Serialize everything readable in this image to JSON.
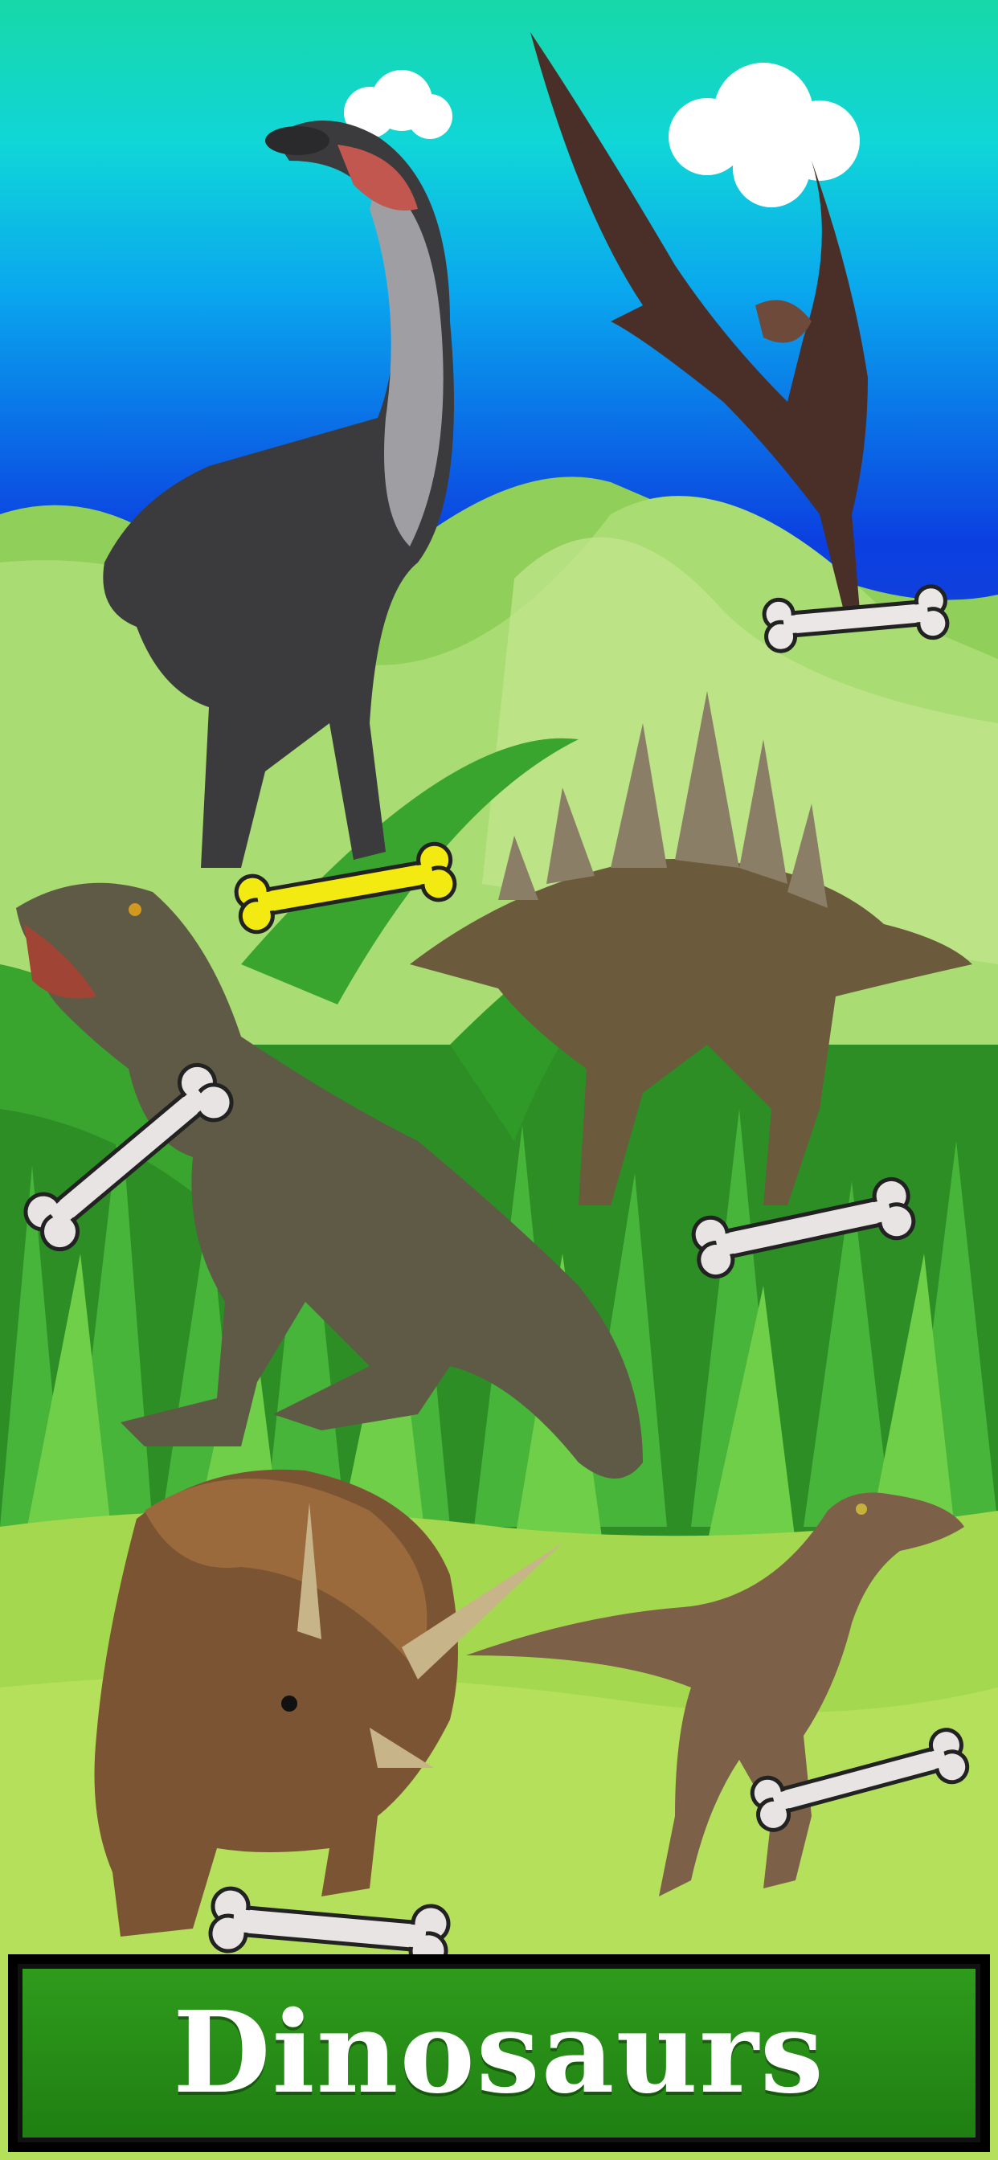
{
  "game": {
    "title": "Dinosaurs"
  },
  "colors": {
    "sky_top": "#17d8a8",
    "sky_bottom": "#0b3fe0",
    "hill": "#9ed86a",
    "grass": "#2f9e2a",
    "banner": "#2a8f18",
    "title_text": "#ffffff",
    "bone": "#e8e4e4",
    "bone_selected": "#f5ec15"
  },
  "dinosaurs": [
    {
      "name": "brachiosaurus",
      "bone": "bone-white"
    },
    {
      "name": "pteranodon",
      "bone": "bone-white"
    },
    {
      "name": "stegosaurus",
      "bone": "bone-white"
    },
    {
      "name": "tyrannosaurus",
      "bone": "bone-white"
    },
    {
      "name": "triceratops",
      "bone": "bone-white"
    },
    {
      "name": "velociraptor",
      "bone": "bone-white"
    }
  ],
  "selected_bone": "brachiosaurus"
}
